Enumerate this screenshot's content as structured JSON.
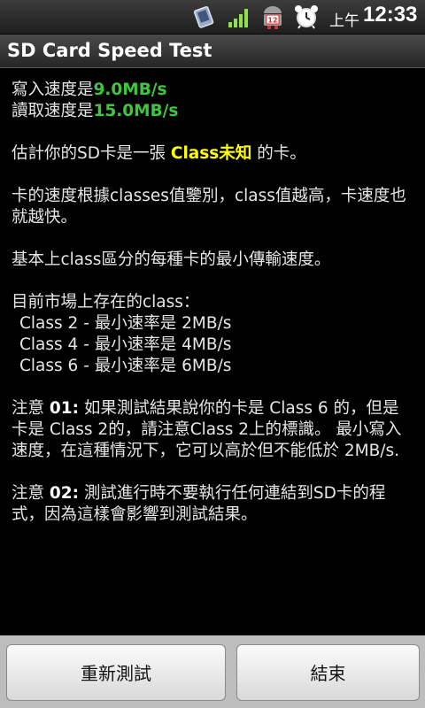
{
  "status_bar": {
    "am_pm": "上午",
    "time": "12:33",
    "notification_count": "12"
  },
  "app": {
    "title": "SD Card Speed Test"
  },
  "results": {
    "write_label": "寫入速度是",
    "write_value": "9.0MB/s",
    "read_label": "讀取速度是",
    "read_value": "15.0MB/s"
  },
  "estimate": {
    "prefix": "估計你的SD卡是一張 ",
    "class_value": "Class未知",
    "suffix": " 的卡。"
  },
  "paragraphs": {
    "class_explanation": "卡的速度根據classes值鑒別，class值越高，卡速度也就越快。",
    "min_speed_intro": "基本上class區分的每種卡的最小傳輸速度。",
    "existing_classes": "目前市場上存在的class："
  },
  "class_list": [
    "Class 2 - 最小速率是 2MB/s",
    "Class 4 - 最小速率是 4MB/s",
    "Class 6 - 最小速率是 6MB/s"
  ],
  "notes": [
    {
      "label": "注意 ",
      "number": "01:",
      "text": " 如果測試結果說你的卡是 Class 6 的，但是卡是 Class 2的，請注意Class 2上的標識。 最小寫入速度，在這種情況下，它可以高於但不能低於 2MB/s."
    },
    {
      "label": "注意 ",
      "number": "02:",
      "text": " 測試進行時不要執行任何連結到SD卡的程式，因為這樣會影響到測試結果。"
    }
  ],
  "buttons": {
    "retest": "重新測試",
    "finish": "結束"
  },
  "colors": {
    "speed_value": "#3ec73e",
    "class_value": "#ffff00",
    "background": "#000000"
  }
}
